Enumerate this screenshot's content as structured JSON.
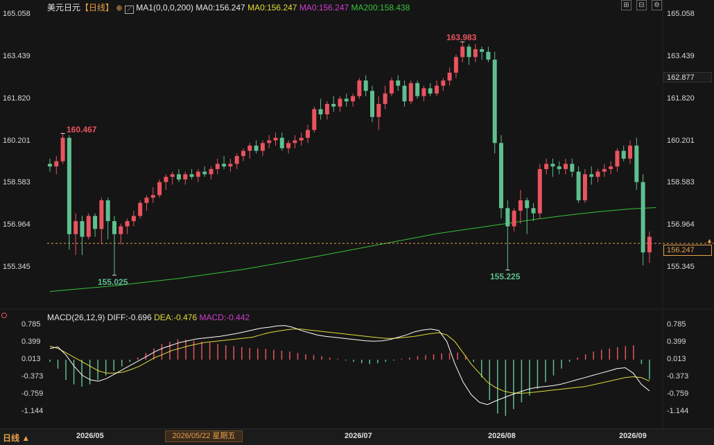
{
  "header": {
    "symbol": "美元日元",
    "period": "【日线】",
    "ma_indicator": "MA1(0,0,0,200)",
    "ma0": "MA0:156.247",
    "ma50": "MA0:156.247",
    "ma_m": "MA0:156.247",
    "ma200": "MA200:158.438"
  },
  "macd_header": {
    "label": "MACD(26,12,9)",
    "diff": "DIFF:-0.696",
    "dea": "DEA:-0.476",
    "macd": "MACD:-0.442"
  },
  "price_axis": {
    "ticks": [
      "165.058",
      "163.439",
      "161.820",
      "160.201",
      "158.583",
      "156.964",
      "155.345"
    ],
    "current_price": "162.877",
    "dashed_price": "156.247"
  },
  "macd_axis": {
    "ticks": [
      "0.785",
      "0.399",
      "0.013",
      "-0.373",
      "-0.759",
      "-1.144"
    ]
  },
  "chart_annotations": {
    "high1": "160.467",
    "low1": "155.025",
    "high2": "163.983",
    "low2": "155.225"
  },
  "x_axis": {
    "labels": [
      "2026/05",
      "2026/07",
      "2026/08",
      "2026/09"
    ],
    "cursor_date": "2026/05/22 星期五"
  },
  "bottom": {
    "period_tab": "日线 ▲"
  },
  "colors": {
    "up": "#e9535f",
    "down": "#5fbf8f",
    "ma_line": "#35c43a",
    "dea": "#e0dd39",
    "diff": "#ffffff",
    "accent": "#e8a04a"
  },
  "chart_data": [
    {
      "type": "candlestick",
      "y_range": [
        155.345,
        165.058
      ],
      "notable_points": [
        {
          "label": "160.467",
          "kind": "high"
        },
        {
          "label": "155.025",
          "kind": "low"
        },
        {
          "label": "163.983",
          "kind": "high"
        },
        {
          "label": "155.225",
          "kind": "low"
        }
      ],
      "ohlc": [
        [
          159.3,
          159.5,
          159.0,
          159.2
        ],
        [
          159.2,
          159.6,
          158.9,
          159.4
        ],
        [
          159.4,
          160.467,
          159.3,
          160.3
        ],
        [
          160.3,
          160.4,
          156.0,
          156.6
        ],
        [
          156.6,
          157.4,
          155.8,
          157.1
        ],
        [
          157.1,
          157.3,
          155.8,
          156.5
        ],
        [
          156.5,
          157.4,
          156.4,
          157.3
        ],
        [
          157.3,
          157.4,
          156.5,
          156.8
        ],
        [
          156.8,
          158.0,
          156.2,
          157.9
        ],
        [
          157.9,
          158.0,
          156.4,
          157.1
        ],
        [
          157.1,
          157.3,
          155.025,
          156.6
        ],
        [
          156.6,
          157.0,
          156.2,
          156.9
        ],
        [
          156.9,
          157.2,
          156.6,
          157.1
        ],
        [
          157.1,
          157.5,
          156.9,
          157.3
        ],
        [
          157.3,
          157.9,
          157.2,
          157.8
        ],
        [
          157.8,
          158.1,
          157.5,
          158.0
        ],
        [
          158.0,
          158.4,
          157.8,
          158.1
        ],
        [
          158.1,
          158.7,
          158.0,
          158.6
        ],
        [
          158.6,
          158.9,
          158.3,
          158.8
        ],
        [
          158.8,
          159.0,
          158.5,
          158.9
        ],
        [
          158.9,
          159.1,
          158.6,
          158.7
        ],
        [
          158.7,
          159.0,
          158.5,
          158.9
        ],
        [
          158.9,
          159.1,
          158.7,
          158.8
        ],
        [
          158.8,
          159.1,
          158.6,
          159.0
        ],
        [
          159.0,
          159.2,
          158.8,
          158.9
        ],
        [
          158.9,
          159.2,
          158.7,
          159.1
        ],
        [
          159.1,
          159.5,
          158.9,
          159.3
        ],
        [
          159.3,
          159.6,
          159.1,
          159.2
        ],
        [
          159.2,
          159.5,
          159.0,
          159.3
        ],
        [
          159.3,
          159.7,
          159.1,
          159.6
        ],
        [
          159.6,
          159.9,
          159.4,
          159.8
        ],
        [
          159.8,
          160.1,
          159.5,
          160.0
        ],
        [
          160.0,
          160.2,
          159.7,
          159.8
        ],
        [
          159.8,
          160.2,
          159.6,
          160.1
        ],
        [
          160.1,
          160.4,
          159.9,
          160.2
        ],
        [
          160.2,
          160.5,
          160.0,
          160.3
        ],
        [
          160.3,
          160.5,
          159.8,
          159.9
        ],
        [
          159.9,
          160.2,
          159.7,
          160.1
        ],
        [
          160.1,
          160.4,
          159.9,
          160.2
        ],
        [
          160.2,
          160.5,
          160.0,
          160.3
        ],
        [
          160.3,
          160.8,
          160.1,
          160.6
        ],
        [
          160.6,
          161.5,
          160.5,
          161.4
        ],
        [
          161.4,
          161.8,
          161.0,
          161.2
        ],
        [
          161.2,
          161.7,
          161.0,
          161.6
        ],
        [
          161.6,
          161.9,
          161.3,
          161.5
        ],
        [
          161.5,
          161.9,
          161.3,
          161.8
        ],
        [
          161.8,
          162.0,
          161.5,
          161.7
        ],
        [
          161.7,
          162.0,
          161.5,
          161.9
        ],
        [
          161.9,
          162.6,
          161.8,
          162.5
        ],
        [
          162.5,
          162.7,
          161.9,
          162.1
        ],
        [
          162.1,
          162.3,
          160.9,
          161.1
        ],
        [
          161.1,
          161.9,
          160.6,
          161.6
        ],
        [
          161.6,
          162.3,
          161.4,
          162.0
        ],
        [
          162.0,
          162.6,
          161.9,
          162.5
        ],
        [
          162.5,
          162.7,
          162.1,
          162.3
        ],
        [
          162.3,
          162.5,
          161.5,
          161.7
        ],
        [
          161.7,
          162.5,
          161.6,
          162.4
        ],
        [
          162.4,
          162.5,
          161.8,
          161.9
        ],
        [
          161.9,
          162.3,
          161.7,
          162.2
        ],
        [
          162.2,
          162.4,
          161.9,
          162.0
        ],
        [
          162.0,
          162.5,
          161.9,
          162.3
        ],
        [
          162.3,
          162.6,
          162.1,
          162.5
        ],
        [
          162.5,
          163.0,
          162.3,
          162.8
        ],
        [
          162.8,
          163.5,
          162.6,
          163.4
        ],
        [
          163.4,
          163.983,
          163.2,
          163.8
        ],
        [
          163.8,
          163.9,
          163.1,
          163.4
        ],
        [
          163.4,
          163.9,
          163.2,
          163.7
        ],
        [
          163.7,
          163.8,
          163.3,
          163.6
        ],
        [
          163.6,
          163.8,
          163.2,
          163.3
        ],
        [
          163.3,
          163.6,
          159.7,
          160.1
        ],
        [
          160.1,
          160.4,
          157.2,
          157.6
        ],
        [
          157.6,
          157.9,
          155.225,
          156.9
        ],
        [
          156.9,
          157.6,
          156.7,
          157.5
        ],
        [
          157.5,
          158.3,
          157.0,
          157.9
        ],
        [
          157.9,
          158.0,
          156.6,
          157.6
        ],
        [
          157.6,
          157.8,
          157.1,
          157.4
        ],
        [
          157.4,
          159.3,
          157.2,
          159.1
        ],
        [
          159.1,
          159.5,
          158.9,
          159.3
        ],
        [
          159.3,
          159.5,
          158.8,
          159.2
        ],
        [
          159.2,
          159.4,
          158.9,
          159.1
        ],
        [
          159.1,
          159.5,
          158.9,
          159.3
        ],
        [
          159.3,
          159.5,
          158.8,
          159.0
        ],
        [
          159.0,
          159.2,
          157.8,
          157.9
        ],
        [
          157.9,
          159.1,
          157.8,
          158.9
        ],
        [
          158.9,
          159.2,
          158.5,
          158.8
        ],
        [
          158.8,
          159.1,
          158.6,
          159.0
        ],
        [
          159.0,
          159.3,
          158.8,
          159.1
        ],
        [
          159.1,
          159.4,
          158.9,
          159.2
        ],
        [
          159.2,
          159.9,
          159.0,
          159.8
        ],
        [
          159.8,
          160.0,
          159.4,
          159.5
        ],
        [
          159.5,
          160.2,
          159.3,
          160.0
        ],
        [
          160.0,
          160.3,
          158.3,
          158.6
        ],
        [
          158.6,
          158.9,
          155.4,
          155.9
        ],
        [
          155.9,
          156.7,
          155.5,
          156.5
        ]
      ],
      "ma200": [
        [
          0,
          154.4
        ],
        [
          10,
          154.62
        ],
        [
          20,
          154.9
        ],
        [
          30,
          155.25
        ],
        [
          40,
          155.68
        ],
        [
          50,
          156.15
        ],
        [
          60,
          156.62
        ],
        [
          70,
          156.98
        ],
        [
          75,
          157.16
        ],
        [
          80,
          157.32
        ],
        [
          85,
          157.46
        ],
        [
          90,
          157.57
        ],
        [
          94,
          157.62
        ]
      ],
      "reference_line": 156.247
    },
    {
      "type": "bar",
      "title": "MACD(26,12,9)",
      "y_range": [
        -1.144,
        0.785
      ],
      "series": [
        {
          "name": "MACD",
          "values": [
            -0.05,
            -0.2,
            -0.45,
            -0.55,
            -0.6,
            -0.55,
            -0.45,
            -0.35,
            -0.25,
            -0.15,
            -0.05,
            0.05,
            0.15,
            0.25,
            0.35,
            0.4,
            0.45,
            0.45,
            0.42,
            0.4,
            0.38,
            0.35,
            0.32,
            0.3,
            0.28,
            0.26,
            0.25,
            0.24,
            0.22,
            0.2,
            0.18,
            0.15,
            0.12,
            0.1,
            0.08,
            0.05,
            0.02,
            -0.02,
            -0.05,
            -0.08,
            -0.1,
            -0.08,
            -0.05,
            -0.02,
            0.02,
            0.05,
            0.08,
            0.1,
            0.12,
            0.14,
            0.15,
            0.16,
            0.1,
            -0.05,
            -0.4,
            -0.9,
            -1.2,
            -1.25,
            -1.1,
            -0.95,
            -0.8,
            -0.65,
            -0.5,
            -0.35,
            -0.2,
            -0.05,
            0.05,
            0.12,
            0.18,
            0.22,
            0.25,
            0.28,
            0.3,
            0.32,
            -0.1,
            -0.442
          ]
        },
        {
          "name": "DIFF",
          "values": [
            0.25,
            0.28,
            0.1,
            -0.15,
            -0.35,
            -0.45,
            -0.48,
            -0.42,
            -0.32,
            -0.22,
            -0.12,
            -0.02,
            0.08,
            0.18,
            0.26,
            0.32,
            0.38,
            0.42,
            0.46,
            0.48,
            0.5,
            0.52,
            0.55,
            0.58,
            0.62,
            0.66,
            0.7,
            0.72,
            0.75,
            0.76,
            0.72,
            0.65,
            0.6,
            0.55,
            0.52,
            0.5,
            0.48,
            0.46,
            0.44,
            0.42,
            0.41,
            0.42,
            0.45,
            0.5,
            0.55,
            0.62,
            0.66,
            0.68,
            0.65,
            0.4,
            -0.1,
            -0.5,
            -0.78,
            -0.95,
            -1.0,
            -0.92,
            -0.85,
            -0.78,
            -0.72,
            -0.66,
            -0.62,
            -0.6,
            -0.58,
            -0.55,
            -0.5,
            -0.45,
            -0.4,
            -0.35,
            -0.3,
            -0.25,
            -0.2,
            -0.18,
            -0.3,
            -0.55,
            -0.696
          ]
        },
        {
          "name": "DEA",
          "values": [
            0.3,
            0.25,
            0.15,
            0.05,
            -0.05,
            -0.15,
            -0.25,
            -0.3,
            -0.3,
            -0.28,
            -0.22,
            -0.15,
            -0.05,
            0.05,
            0.12,
            0.2,
            0.25,
            0.3,
            0.34,
            0.38,
            0.4,
            0.42,
            0.44,
            0.46,
            0.48,
            0.5,
            0.55,
            0.6,
            0.63,
            0.66,
            0.68,
            0.68,
            0.66,
            0.64,
            0.62,
            0.6,
            0.58,
            0.56,
            0.54,
            0.52,
            0.5,
            0.48,
            0.47,
            0.48,
            0.5,
            0.52,
            0.55,
            0.58,
            0.6,
            0.55,
            0.4,
            0.15,
            -0.1,
            -0.3,
            -0.5,
            -0.62,
            -0.7,
            -0.74,
            -0.75,
            -0.74,
            -0.72,
            -0.7,
            -0.68,
            -0.66,
            -0.64,
            -0.62,
            -0.6,
            -0.56,
            -0.52,
            -0.48,
            -0.44,
            -0.4,
            -0.38,
            -0.4,
            -0.476
          ]
        }
      ]
    }
  ]
}
